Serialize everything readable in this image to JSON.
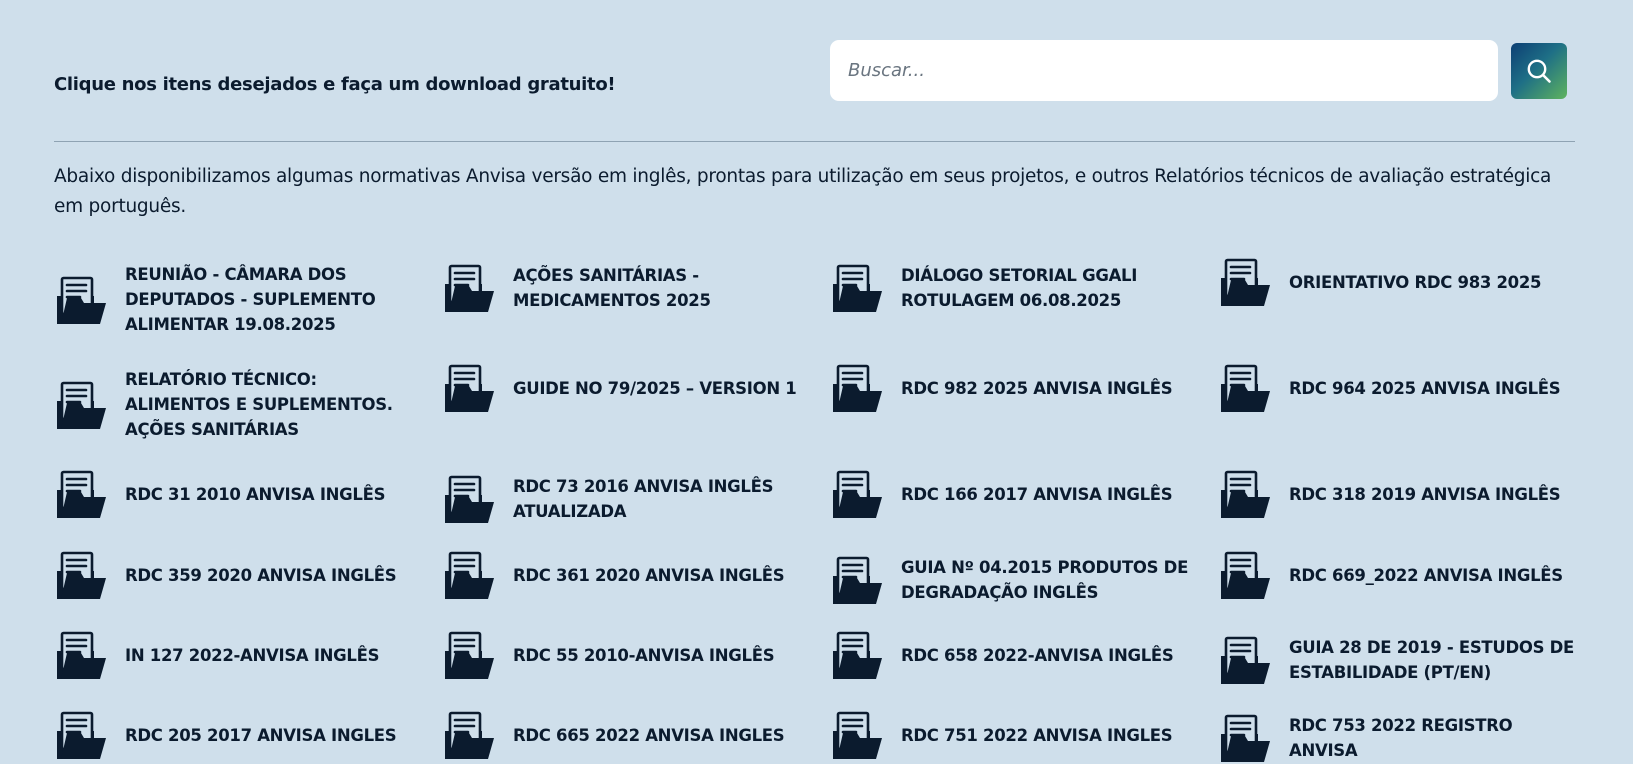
{
  "header": {
    "headline": "Clique nos itens desejados e faça um download gratuito!"
  },
  "search": {
    "placeholder": "Buscar...",
    "value": "",
    "button_icon": "search-icon"
  },
  "intro_text": "Abaixo disponibilizamos algumas normativas Anvisa versão em inglês, prontas para utilização em seus projetos, e outros Relatórios técnicos de avaliação estratégica em português.",
  "documents": {
    "icon": "folder-document-icon",
    "items": [
      {
        "label": "REUNIÃO - CÂMARA DOS DEPUTADOS - SUPLEMENTO ALIMENTAR 19.08.2025"
      },
      {
        "label": "AÇÕES SANITÁRIAS - MEDICAMENTOS 2025"
      },
      {
        "label": "DIÁLOGO SETORIAL GGALI ROTULAGEM 06.08.2025"
      },
      {
        "label": "ORIENTATIVO RDC 983 2025"
      },
      {
        "label": "RELATÓRIO TÉCNICO: ALIMENTOS E SUPLEMENTOS. AÇÕES SANITÁRIAS"
      },
      {
        "label": "GUIDE NO 79/2025 – VERSION 1"
      },
      {
        "label": "RDC 982 2025 ANVISA INGLÊS"
      },
      {
        "label": "RDC 964 2025 ANVISA INGLÊS"
      },
      {
        "label": "RDC 31 2010 ANVISA INGLÊS"
      },
      {
        "label": "RDC 73 2016 ANVISA INGLÊS ATUALIZADA"
      },
      {
        "label": "RDC 166 2017 ANVISA INGLÊS"
      },
      {
        "label": "RDC 318 2019 ANVISA INGLÊS"
      },
      {
        "label": "RDC 359 2020 ANVISA INGLÊS"
      },
      {
        "label": "RDC 361 2020 ANVISA INGLÊS"
      },
      {
        "label": "GUIA Nº 04.2015 PRODUTOS DE DEGRADAÇÃO INGLÊS"
      },
      {
        "label": "RDC 669_2022 ANVISA INGLÊS"
      },
      {
        "label": "IN 127 2022-ANVISA INGLÊS"
      },
      {
        "label": "RDC 55 2010-ANVISA INGLÊS"
      },
      {
        "label": "RDC 658 2022-ANVISA INGLÊS"
      },
      {
        "label": "GUIA 28 DE 2019 - ESTUDOS DE ESTABILIDADE (PT/EN)"
      },
      {
        "label": "RDC 205 2017 ANVISA INGLES"
      },
      {
        "label": "RDC 665 2022 ANVISA INGLES"
      },
      {
        "label": "RDC 751 2022 ANVISA INGLES"
      },
      {
        "label": "RDC 753 2022 REGISTRO ANVISA"
      }
    ]
  },
  "colors": {
    "page_background": "#cfdfeb",
    "text": "#0b1b2e",
    "icon": "#0b1b2e",
    "search_button_gradient": [
      "#0d3f74",
      "#5fb35e"
    ]
  }
}
